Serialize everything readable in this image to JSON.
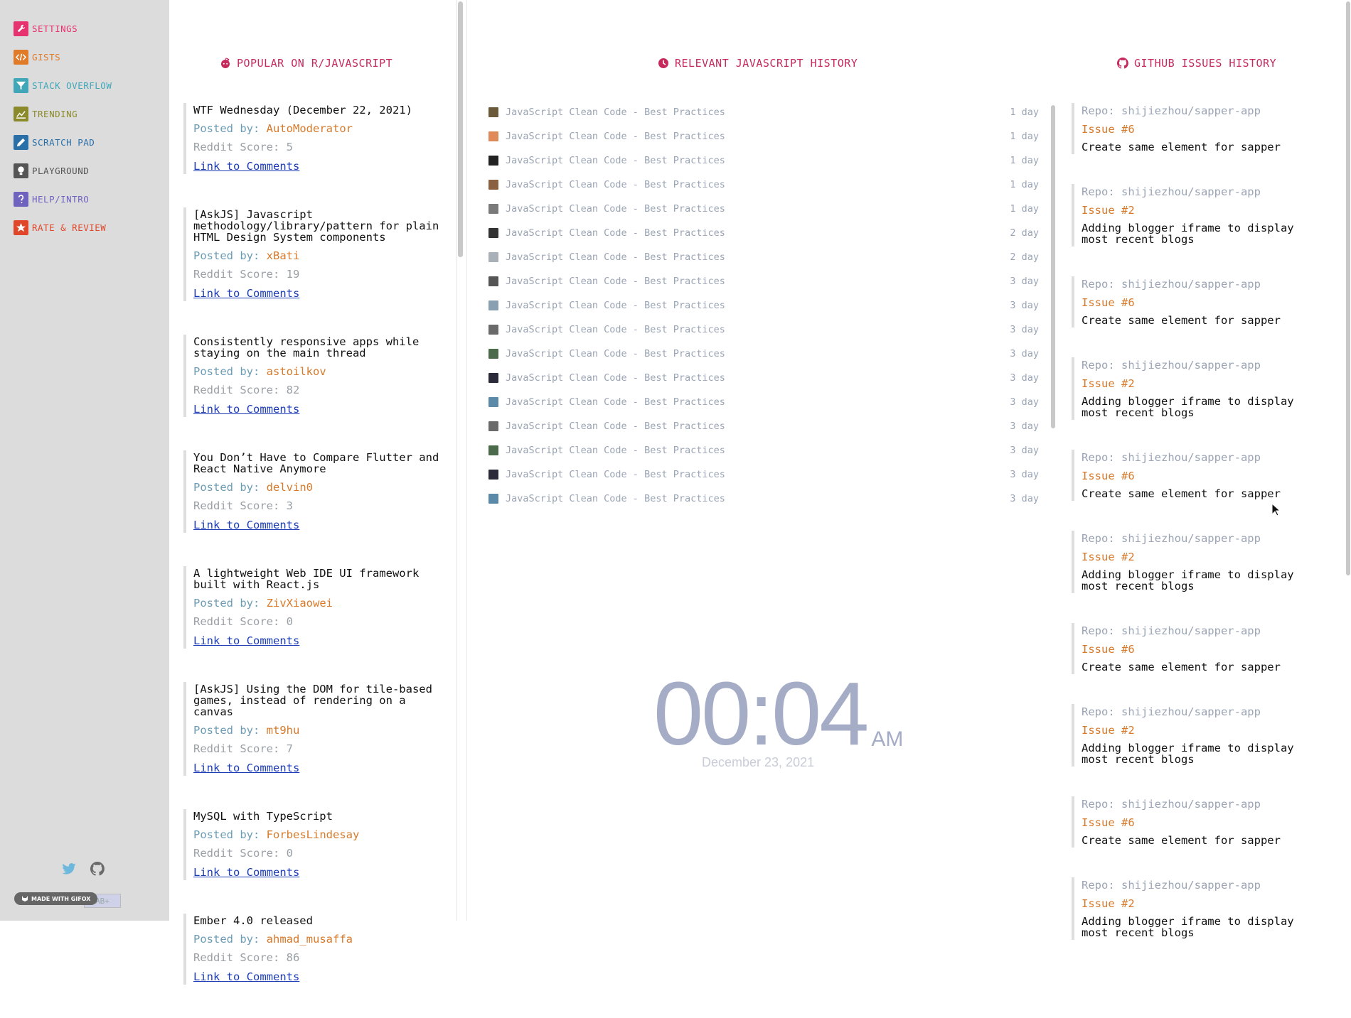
{
  "sidebar": {
    "items": [
      {
        "label": "SETTINGS",
        "icon": "wrench-icon",
        "color": "#e6326e"
      },
      {
        "label": "GISTS",
        "icon": "code-icon",
        "color": "#e07b2a"
      },
      {
        "label": "STACK OVERFLOW",
        "icon": "filter-icon",
        "color": "#3fa7b8"
      },
      {
        "label": "TRENDING",
        "icon": "chart-icon",
        "color": "#8a8a2a"
      },
      {
        "label": "SCRATCH PAD",
        "icon": "pencil-icon",
        "color": "#2a6fa7"
      },
      {
        "label": "PLAYGROUND",
        "icon": "bulb-icon",
        "color": "#555555"
      },
      {
        "label": "HELP/INTRO",
        "icon": "question-icon",
        "color": "#6f63c0"
      },
      {
        "label": "RATE & REVIEW",
        "icon": "star-icon",
        "color": "#e0472a"
      }
    ],
    "badge": "MADE WITH GIFOX"
  },
  "reddit": {
    "title": "POPULAR ON R/JAVASCRIPT",
    "posted_label": "Posted by:",
    "score_label": "Reddit Score:",
    "link_label": "Link to Comments",
    "posts": [
      {
        "title": "WTF Wednesday (December 22, 2021)",
        "author": "AutoModerator",
        "score": "5"
      },
      {
        "title": "[AskJS] Javascript methodology/library/pattern for plain HTML Design System components",
        "author": "xBati",
        "score": "19"
      },
      {
        "title": "Consistently responsive apps while staying on the main thread",
        "author": "astoilkov",
        "score": "82"
      },
      {
        "title": "You Don’t Have to Compare Flutter and React Native Anymore",
        "author": "delvin0",
        "score": "3"
      },
      {
        "title": "A lightweight Web IDE UI framework built with React.js",
        "author": "ZivXiaowei",
        "score": "0"
      },
      {
        "title": "[AskJS] Using the DOM for tile-based games, instead of rendering on a canvas",
        "author": "mt9hu",
        "score": "7"
      },
      {
        "title": "MySQL with TypeScript",
        "author": "ForbesLindesay",
        "score": "0"
      },
      {
        "title": "Ember 4.0 released",
        "author": "ahmad_musaffa",
        "score": "86"
      }
    ]
  },
  "history": {
    "title": "RELEVANT JAVASCRIPT HISTORY",
    "items": [
      {
        "title": "JavaScript Clean Code - Best Practices",
        "age": "1 day",
        "thumb": "#6b5a3a"
      },
      {
        "title": "JavaScript Clean Code - Best Practices",
        "age": "1 day",
        "thumb": "#e08a5a"
      },
      {
        "title": "JavaScript Clean Code - Best Practices",
        "age": "1 day",
        "thumb": "#222222"
      },
      {
        "title": "JavaScript Clean Code - Best Practices",
        "age": "1 day",
        "thumb": "#8a6040"
      },
      {
        "title": "JavaScript Clean Code - Best Practices",
        "age": "1 day",
        "thumb": "#7a7a7a"
      },
      {
        "title": "JavaScript Clean Code - Best Practices",
        "age": "2 day",
        "thumb": "#333333"
      },
      {
        "title": "JavaScript Clean Code - Best Practices",
        "age": "2 day",
        "thumb": "#aab0b8"
      },
      {
        "title": "JavaScript Clean Code - Best Practices",
        "age": "3 day",
        "thumb": "#555555"
      },
      {
        "title": "JavaScript Clean Code - Best Practices",
        "age": "3 day",
        "thumb": "#8aa0b0"
      },
      {
        "title": "JavaScript Clean Code - Best Practices",
        "age": "3 day",
        "thumb": "#6a6a6a"
      },
      {
        "title": "JavaScript Clean Code - Best Practices",
        "age": "3 day",
        "thumb": "#4a6a4a"
      },
      {
        "title": "JavaScript Clean Code - Best Practices",
        "age": "3 day",
        "thumb": "#2a2a3a"
      },
      {
        "title": "JavaScript Clean Code - Best Practices",
        "age": "3 day",
        "thumb": "#5a8aa8"
      },
      {
        "title": "JavaScript Clean Code - Best Practices",
        "age": "3 day",
        "thumb": "#6a6a6a"
      },
      {
        "title": "JavaScript Clean Code - Best Practices",
        "age": "3 day",
        "thumb": "#4a6a4a"
      },
      {
        "title": "JavaScript Clean Code - Best Practices",
        "age": "3 day",
        "thumb": "#2a2a3a"
      },
      {
        "title": "JavaScript Clean Code - Best Practices",
        "age": "3 day",
        "thumb": "#5a8aa8"
      }
    ]
  },
  "clock": {
    "time": "00:04",
    "ampm": "AM",
    "date": "December 23, 2021"
  },
  "issues": {
    "title": "GITHUB ISSUES HISTORY",
    "items": [
      {
        "repo": "Repo: shijiezhou/sapper-app",
        "num": "Issue #6",
        "title": "Create same element for sapper"
      },
      {
        "repo": "Repo: shijiezhou/sapper-app",
        "num": "Issue #2",
        "title": "Adding blogger iframe to display most recent blogs"
      },
      {
        "repo": "Repo: shijiezhou/sapper-app",
        "num": "Issue #6",
        "title": "Create same element for sapper"
      },
      {
        "repo": "Repo: shijiezhou/sapper-app",
        "num": "Issue #2",
        "title": "Adding blogger iframe to display most recent blogs"
      },
      {
        "repo": "Repo: shijiezhou/sapper-app",
        "num": "Issue #6",
        "title": "Create same element for sapper"
      },
      {
        "repo": "Repo: shijiezhou/sapper-app",
        "num": "Issue #2",
        "title": "Adding blogger iframe to display most recent blogs"
      },
      {
        "repo": "Repo: shijiezhou/sapper-app",
        "num": "Issue #6",
        "title": "Create same element for sapper"
      },
      {
        "repo": "Repo: shijiezhou/sapper-app",
        "num": "Issue #2",
        "title": "Adding blogger iframe to display most recent blogs"
      },
      {
        "repo": "Repo: shijiezhou/sapper-app",
        "num": "Issue #6",
        "title": "Create same element for sapper"
      },
      {
        "repo": "Repo: shijiezhou/sapper-app",
        "num": "Issue #2",
        "title": "Adding blogger iframe to display most recent blogs"
      }
    ]
  }
}
